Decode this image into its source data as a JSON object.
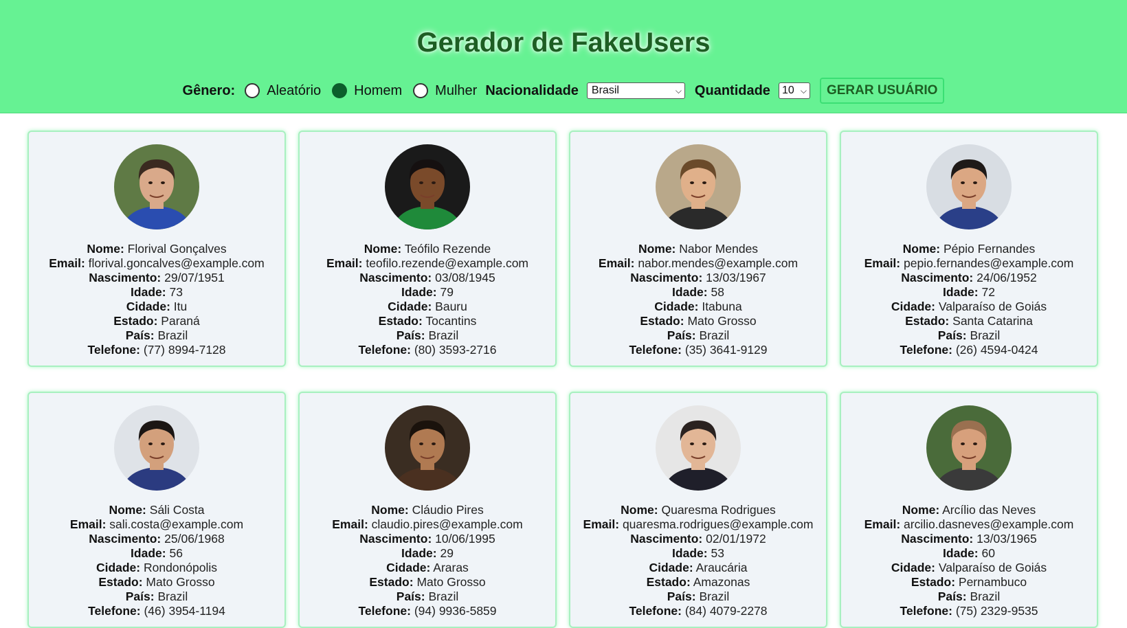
{
  "header": {
    "title": "Gerador de FakeUsers",
    "gender_label": "Gênero:",
    "gender_options": [
      "Aleatório",
      "Homem",
      "Mulher"
    ],
    "gender_selected": "Homem",
    "nationality_label": "Nacionalidade",
    "nationality_value": "Brasil",
    "quantity_label": "Quantidade",
    "quantity_value": "10",
    "generate_button": "GERAR USUÁRIO"
  },
  "field_labels": {
    "name": "Nome:",
    "email": "Email:",
    "birth": "Nascimento:",
    "age": "Idade:",
    "city": "Cidade:",
    "state": "Estado:",
    "country": "País:",
    "phone": "Telefone:"
  },
  "users": [
    {
      "name": "Florival Gonçalves",
      "email": "florival.goncalves@example.com",
      "birth": "29/07/1951",
      "age": "73",
      "city": "Itu",
      "state": "Paraná",
      "country": "Brazil",
      "phone": "(77) 8994-7128"
    },
    {
      "name": "Teófilo Rezende",
      "email": "teofilo.rezende@example.com",
      "birth": "03/08/1945",
      "age": "79",
      "city": "Bauru",
      "state": "Tocantins",
      "country": "Brazil",
      "phone": "(80) 3593-2716"
    },
    {
      "name": "Nabor Mendes",
      "email": "nabor.mendes@example.com",
      "birth": "13/03/1967",
      "age": "58",
      "city": "Itabuna",
      "state": "Mato Grosso",
      "country": "Brazil",
      "phone": "(35) 3641-9129"
    },
    {
      "name": "Pépio Fernandes",
      "email": "pepio.fernandes@example.com",
      "birth": "24/06/1952",
      "age": "72",
      "city": "Valparaíso de Goiás",
      "state": "Santa Catarina",
      "country": "Brazil",
      "phone": "(26) 4594-0424"
    },
    {
      "name": "Sáli Costa",
      "email": "sali.costa@example.com",
      "birth": "25/06/1968",
      "age": "56",
      "city": "Rondonópolis",
      "state": "Mato Grosso",
      "country": "Brazil",
      "phone": "(46) 3954-1194"
    },
    {
      "name": "Cláudio Pires",
      "email": "claudio.pires@example.com",
      "birth": "10/06/1995",
      "age": "29",
      "city": "Araras",
      "state": "Mato Grosso",
      "country": "Brazil",
      "phone": "(94) 9936-5859"
    },
    {
      "name": "Quaresma Rodrigues",
      "email": "quaresma.rodrigues@example.com",
      "birth": "02/01/1972",
      "age": "53",
      "city": "Araucária",
      "state": "Amazonas",
      "country": "Brazil",
      "phone": "(84) 4079-2278"
    },
    {
      "name": "Arcílio das Neves",
      "email": "arcilio.dasneves@example.com",
      "birth": "13/03/1965",
      "age": "60",
      "city": "Valparaíso de Goiás",
      "state": "Pernambuco",
      "country": "Brazil",
      "phone": "(75) 2329-9535"
    }
  ],
  "avatars": [
    {
      "bg": "#5f7a45",
      "skin": "#d9a98a",
      "hair": "#3a2a20",
      "shirt": "#2a4db0"
    },
    {
      "bg": "#1a1a1a",
      "skin": "#7a4a2a",
      "hair": "#151010",
      "shirt": "#1f8a3a"
    },
    {
      "bg": "#b9a88a",
      "skin": "#e0b08a",
      "hair": "#6a4a2a",
      "shirt": "#2a2a2a"
    },
    {
      "bg": "#d8dde3",
      "skin": "#dba783",
      "hair": "#1f1a18",
      "shirt": "#2a3f88"
    },
    {
      "bg": "#dfe3e8",
      "skin": "#d3a07c",
      "hair": "#1b1614",
      "shirt": "#2b3b80"
    },
    {
      "bg": "#3a2d22",
      "skin": "#b07a52",
      "hair": "#1a120c",
      "shirt": "#4a3020"
    },
    {
      "bg": "#e6e6e6",
      "skin": "#e2b696",
      "hair": "#2a2220",
      "shirt": "#1f1f2a"
    },
    {
      "bg": "#4a6b3a",
      "skin": "#d7a07c",
      "hair": "#9a7050",
      "shirt": "#3a3a3a"
    }
  ]
}
